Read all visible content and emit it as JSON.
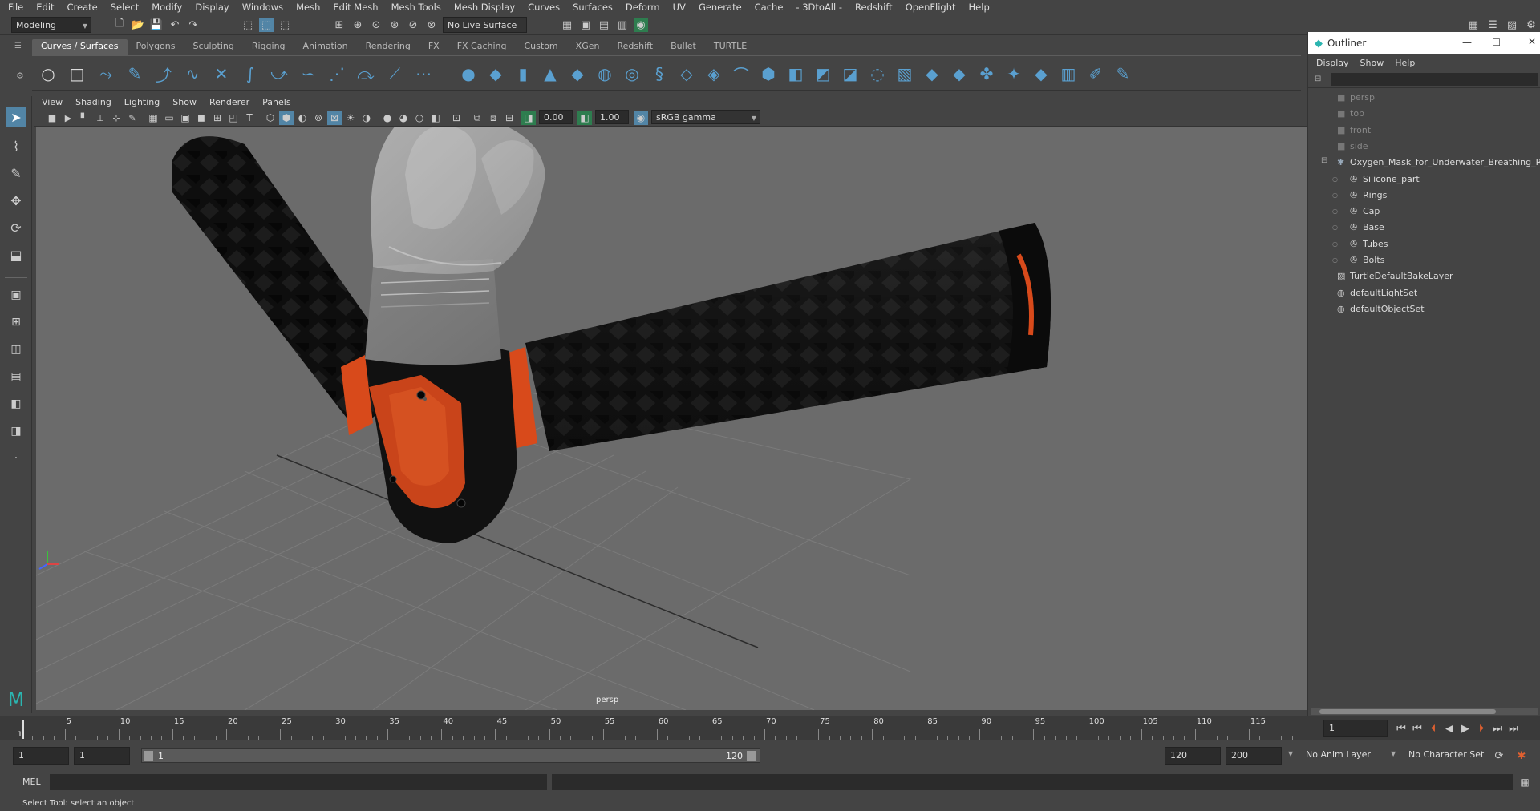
{
  "menubar": [
    "File",
    "Edit",
    "Create",
    "Select",
    "Modify",
    "Display",
    "Windows",
    "Mesh",
    "Edit Mesh",
    "Mesh Tools",
    "Mesh Display",
    "Curves",
    "Surfaces",
    "Deform",
    "UV",
    "Generate",
    "Cache",
    "- 3DtoAll -",
    "Redshift",
    "OpenFlight",
    "Help"
  ],
  "status": {
    "mode": "Modeling",
    "live_surface": "No Live Surface"
  },
  "shelf_tabs": [
    "Curves / Surfaces",
    "Polygons",
    "Sculpting",
    "Rigging",
    "Animation",
    "Rendering",
    "FX",
    "FX Caching",
    "Custom",
    "XGen",
    "Redshift",
    "Bullet",
    "TURTLE"
  ],
  "panel_menu": [
    "View",
    "Shading",
    "Lighting",
    "Show",
    "Renderer",
    "Panels"
  ],
  "panel_toolbar": {
    "exposure": "0.00",
    "gamma": "1.00",
    "color_space": "sRGB gamma"
  },
  "viewport": {
    "camera_label": "persp"
  },
  "outliner": {
    "title": "Outliner",
    "menu": [
      "Display",
      "Show",
      "Help"
    ],
    "items": [
      {
        "label": "persp"
      },
      {
        "label": "top"
      },
      {
        "label": "front"
      },
      {
        "label": "side"
      },
      {
        "label": "Oxygen_Mask_for_Underwater_Breathing_R"
      },
      {
        "label": "Silicone_part"
      },
      {
        "label": "Rings"
      },
      {
        "label": "Cap"
      },
      {
        "label": "Base"
      },
      {
        "label": "Tubes"
      },
      {
        "label": "Bolts"
      },
      {
        "label": "TurtleDefaultBakeLayer"
      },
      {
        "label": "defaultLightSet"
      },
      {
        "label": "defaultObjectSet"
      }
    ]
  },
  "timeline": {
    "ticks": [
      "5",
      "10",
      "15",
      "20",
      "25",
      "30",
      "35",
      "40",
      "45",
      "50",
      "55",
      "60",
      "65",
      "70",
      "75",
      "80",
      "85",
      "90",
      "95",
      "100",
      "105",
      "110",
      "115"
    ],
    "current_frame": "1",
    "playhead_marker": "1"
  },
  "range": {
    "start": "1",
    "playback_start": "1",
    "slider_start": "1",
    "slider_end": "120",
    "playback_end": "120",
    "end": "200",
    "anim_layer": "No Anim Layer",
    "character_set": "No Character Set"
  },
  "cmdline": {
    "lang": "MEL"
  },
  "help_line": "Select Tool: select an object",
  "colors": {
    "accent": "#5285a6",
    "orange": "#d84a1b",
    "viewport_bg": "#6b6b6b",
    "panel": "#444444"
  }
}
